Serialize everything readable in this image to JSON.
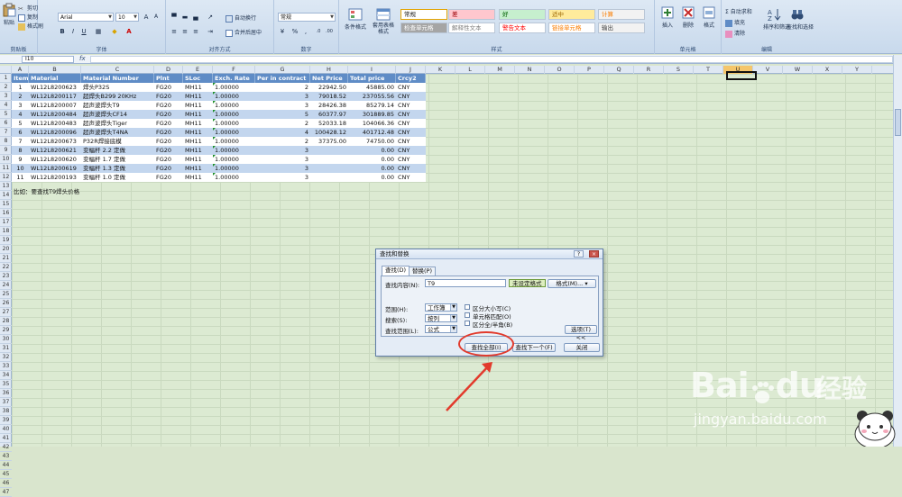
{
  "ribbon": {
    "clipboard": {
      "paste": "粘贴",
      "cut": "剪切",
      "copy": "复制",
      "format_painter": "格式刷",
      "label": "剪贴板"
    },
    "font": {
      "name": "Arial",
      "size": "10",
      "label": "字体"
    },
    "alignment": {
      "wrap": "自动换行",
      "merge": "合并后居中",
      "label": "对齐方式"
    },
    "number": {
      "format": "常规",
      "label": "数字"
    },
    "styles": {
      "cond_format": "条件格式",
      "table_format": "套用表格格式",
      "cells": [
        {
          "text": "常规",
          "bg": "#ffffff",
          "fg": "#111111"
        },
        {
          "text": "差",
          "bg": "#ffc7ce",
          "fg": "#9c0006"
        },
        {
          "text": "好",
          "bg": "#c6efce",
          "fg": "#006100"
        },
        {
          "text": "适中",
          "bg": "#ffeb9c",
          "fg": "#9c6500"
        },
        {
          "text": "计算",
          "bg": "#f2f2f2",
          "fg": "#fa7d00"
        },
        {
          "text": "检查单元格",
          "bg": "#a5a5a5",
          "fg": "#ffffff"
        },
        {
          "text": "解释性文本",
          "bg": "#ffffff",
          "fg": "#7f7f7f"
        },
        {
          "text": "警告文本",
          "bg": "#ffffff",
          "fg": "#ff0000"
        },
        {
          "text": "链接单元格",
          "bg": "#ffffff",
          "fg": "#fa7d00"
        },
        {
          "text": "输出",
          "bg": "#f2f2f2",
          "fg": "#3f3f3f"
        }
      ],
      "label": "样式"
    },
    "cells_group": {
      "insert": "插入",
      "delete": "删除",
      "format": "格式",
      "label": "单元格"
    },
    "editing": {
      "autosum": "自动求和",
      "fill": "填充",
      "clear": "清除",
      "sort": "排序和筛选",
      "find": "查找和选择",
      "label": "编辑"
    }
  },
  "formula_bar": {
    "name_box": "I10",
    "fx": "fx",
    "content": ""
  },
  "columns": [
    "A",
    "B",
    "C",
    "D",
    "E",
    "F",
    "G",
    "H",
    "I",
    "J",
    "K",
    "L",
    "M",
    "N",
    "O",
    "P",
    "Q",
    "R",
    "S",
    "T",
    "U",
    "V",
    "W",
    "X",
    "Y"
  ],
  "selected_column": "U",
  "rows": [
    "1",
    "2",
    "3",
    "4",
    "5",
    "6",
    "7",
    "8",
    "9",
    "10",
    "11",
    "12",
    "13",
    "14",
    "15",
    "16",
    "17",
    "18",
    "19",
    "20",
    "21",
    "22",
    "23",
    "24",
    "25",
    "26",
    "27",
    "28",
    "29",
    "30",
    "31",
    "32",
    "33",
    "34",
    "35",
    "36",
    "37",
    "38",
    "39",
    "40",
    "41",
    "42",
    "43",
    "44",
    "45",
    "46",
    "47"
  ],
  "table": {
    "headers": [
      "Item",
      "Material",
      "Material Number",
      "Plnt",
      "SLoc",
      "Exch. Rate",
      "Per in contract",
      "Net Price",
      "Total price",
      "Crcy2"
    ],
    "rows": [
      [
        "1",
        "WL12L8200623",
        "焊头P32S",
        "FG20",
        "MH11",
        "1.00000",
        "2",
        "22942.50",
        "45885.00",
        "CNY"
      ],
      [
        "2",
        "WL12L8200117",
        "超焊头B299 20KHz",
        "FG20",
        "MH11",
        "1.00000",
        "3",
        "79018.52",
        "237055.56",
        "CNY"
      ],
      [
        "3",
        "WL12L8200007",
        "超声波焊头T9",
        "FG20",
        "MH11",
        "1.00000",
        "3",
        "28426.38",
        "85279.14",
        "CNY"
      ],
      [
        "4",
        "WL12L8200484",
        "超声波焊头CF14",
        "FG20",
        "MH11",
        "1.00000",
        "5",
        "60377.97",
        "301889.85",
        "CNY"
      ],
      [
        "5",
        "WL12L8200483",
        "超声波焊头Tiger",
        "FG20",
        "MH11",
        "1.00000",
        "2",
        "52033.18",
        "104066.36",
        "CNY"
      ],
      [
        "6",
        "WL12L8200096",
        "超声波焊头T4NA",
        "FG20",
        "MH11",
        "1.00000",
        "4",
        "100428.12",
        "401712.48",
        "CNY"
      ],
      [
        "7",
        "WL12L8200673",
        "P32R焊接底模",
        "FG20",
        "MH11",
        "1.00000",
        "2",
        "37375.00",
        "74750.00",
        "CNY"
      ],
      [
        "8",
        "WL12L8200621",
        "变幅杆 2.2 定做",
        "FG20",
        "MH11",
        "1.00000",
        "3",
        "",
        "0.00",
        "CNY"
      ],
      [
        "9",
        "WL12L8200620",
        "变幅杆 1.7 定做",
        "FG20",
        "MH11",
        "1.00000",
        "3",
        "",
        "0.00",
        "CNY"
      ],
      [
        "10",
        "WL12L8200619",
        "变幅杆 1.3 定做",
        "FG20",
        "MH11",
        "1.00000",
        "3",
        "",
        "0.00",
        "CNY"
      ],
      [
        "11",
        "WL12L8200193",
        "变幅杆 1.0 定做",
        "FG20",
        "MH11",
        "1.00000",
        "3",
        "",
        "0.00",
        "CNY"
      ]
    ]
  },
  "note": "比如：要查找T9焊头价格",
  "dialog": {
    "title": "查找和替换",
    "help": "?",
    "close": "×",
    "tab_find": "查找(D)",
    "tab_replace": "替换(P)",
    "find_label": "查找内容(N):",
    "find_value": "T9",
    "format_state": "未设定格式",
    "format_button": "格式(M)...",
    "within_label": "范围(H):",
    "within_value": "工作簿",
    "search_label": "搜索(S):",
    "search_value": "按列",
    "lookin_label": "查找范围(L):",
    "lookin_value": "公式",
    "match_case": "区分大小写(C)",
    "match_cell": "单元格匹配(O)",
    "match_width": "区分全/半角(B)",
    "options_button": "选项(T) <<",
    "find_all": "查找全部(I)",
    "find_next": "查找下一个(F)",
    "close_button": "关闭"
  },
  "watermark": {
    "brand": "Bai",
    "brand2": "du",
    "zh": "经验",
    "url": "jingyan.baidu.com"
  }
}
